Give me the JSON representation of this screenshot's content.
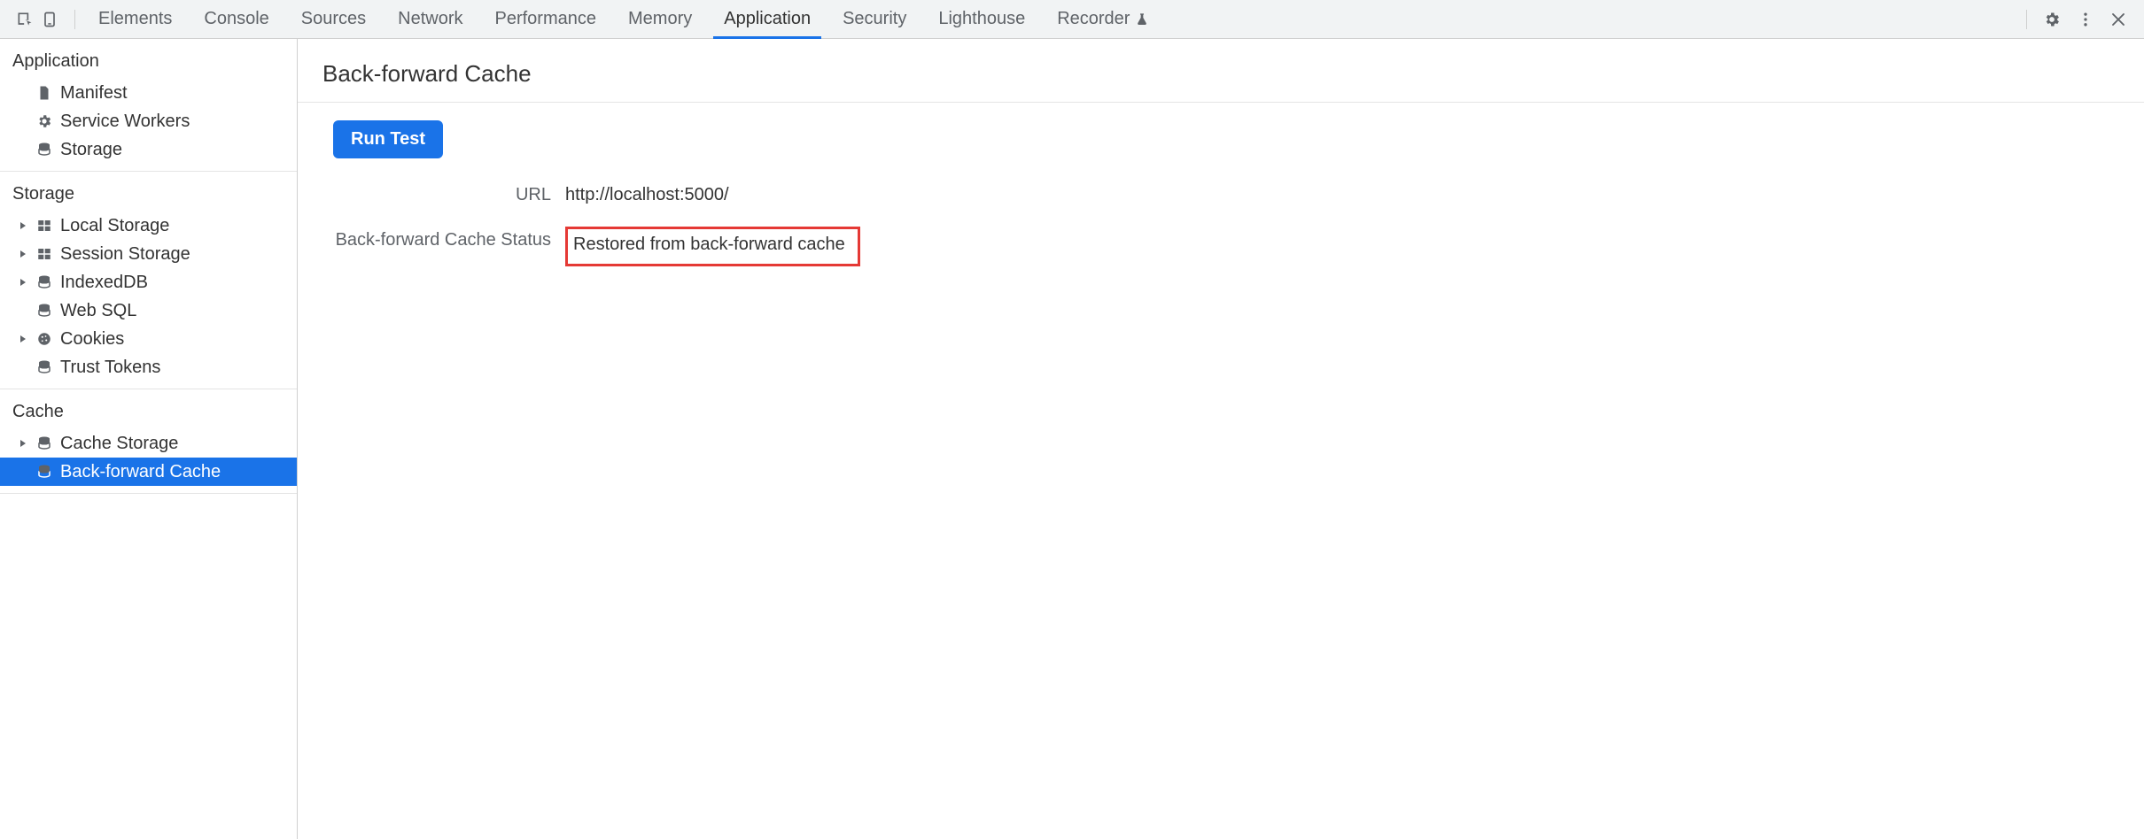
{
  "toolbar": {
    "tabs": [
      {
        "label": "Elements",
        "active": false
      },
      {
        "label": "Console",
        "active": false
      },
      {
        "label": "Sources",
        "active": false
      },
      {
        "label": "Network",
        "active": false
      },
      {
        "label": "Performance",
        "active": false
      },
      {
        "label": "Memory",
        "active": false
      },
      {
        "label": "Application",
        "active": true
      },
      {
        "label": "Security",
        "active": false
      },
      {
        "label": "Lighthouse",
        "active": false
      },
      {
        "label": "Recorder",
        "active": false,
        "has_icon": true
      }
    ]
  },
  "sidebar": {
    "sections": [
      {
        "title": "Application",
        "items": [
          {
            "label": "Manifest",
            "icon": "document-icon",
            "expandable": false,
            "selected": false
          },
          {
            "label": "Service Workers",
            "icon": "gear-icon",
            "expandable": false,
            "selected": false
          },
          {
            "label": "Storage",
            "icon": "database-icon",
            "expandable": false,
            "selected": false
          }
        ]
      },
      {
        "title": "Storage",
        "items": [
          {
            "label": "Local Storage",
            "icon": "table-icon",
            "expandable": true,
            "selected": false
          },
          {
            "label": "Session Storage",
            "icon": "table-icon",
            "expandable": true,
            "selected": false
          },
          {
            "label": "IndexedDB",
            "icon": "database-icon",
            "expandable": true,
            "selected": false
          },
          {
            "label": "Web SQL",
            "icon": "database-icon",
            "expandable": false,
            "selected": false
          },
          {
            "label": "Cookies",
            "icon": "cookie-icon",
            "expandable": true,
            "selected": false
          },
          {
            "label": "Trust Tokens",
            "icon": "database-icon",
            "expandable": false,
            "selected": false
          }
        ]
      },
      {
        "title": "Cache",
        "items": [
          {
            "label": "Cache Storage",
            "icon": "database-icon",
            "expandable": true,
            "selected": false
          },
          {
            "label": "Back-forward Cache",
            "icon": "database-icon",
            "expandable": false,
            "selected": true
          }
        ]
      }
    ]
  },
  "main": {
    "title": "Back-forward Cache",
    "run_button_label": "Run Test",
    "rows": {
      "url_label": "URL",
      "url_value": "http://localhost:5000/",
      "status_label": "Back-forward Cache Status",
      "status_value": "Restored from back-forward cache"
    }
  }
}
